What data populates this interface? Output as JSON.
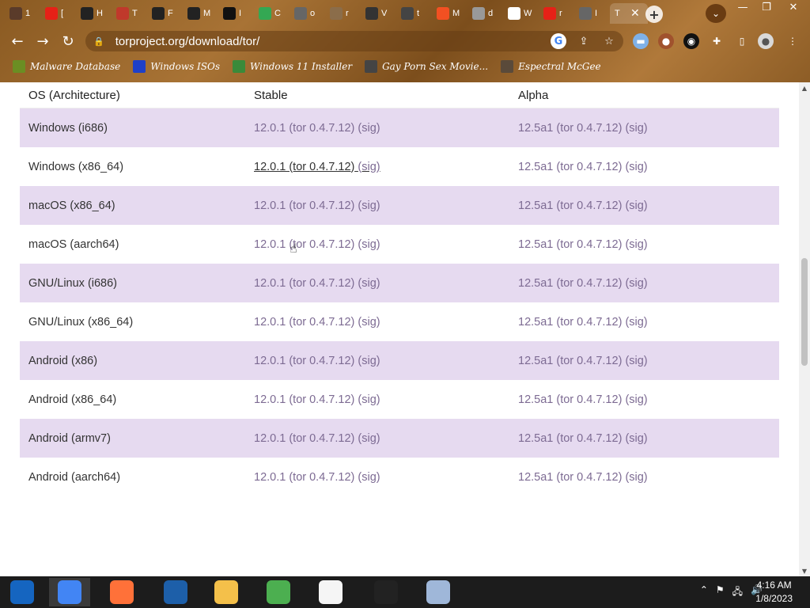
{
  "browser": {
    "tabs": [
      {
        "label": "1",
        "icon": "panda-icon",
        "color": "#5a3b2a"
      },
      {
        "label": "[",
        "icon": "youtube-icon",
        "color": "#e62117"
      },
      {
        "label": "H",
        "icon": "mask-icon",
        "color": "#222222"
      },
      {
        "label": "T",
        "icon": "bookmark-icon",
        "color": "#c0392b"
      },
      {
        "label": "F",
        "icon": "mask-icon",
        "color": "#222222"
      },
      {
        "label": "M",
        "icon": "mask-icon",
        "color": "#222222"
      },
      {
        "label": "I",
        "icon": "ip-icon",
        "color": "#111111"
      },
      {
        "label": "C",
        "icon": "maps-icon",
        "color": "#34a853"
      },
      {
        "label": "o",
        "icon": "globe-icon",
        "color": "#666666"
      },
      {
        "label": "r",
        "icon": "cookie-icon",
        "color": "#8b6d4a"
      },
      {
        "label": "V",
        "icon": "museum-icon",
        "color": "#333333"
      },
      {
        "label": "t",
        "icon": "vs-icon",
        "color": "#444444"
      },
      {
        "label": "M",
        "icon": "windows-icon",
        "color": "#f25022"
      },
      {
        "label": "d",
        "icon": "badge-icon",
        "color": "#999999"
      },
      {
        "label": "W",
        "icon": "wikipedia-icon",
        "color": "#ffffff"
      },
      {
        "label": "r",
        "icon": "youtube-icon",
        "color": "#e62117"
      },
      {
        "label": "I",
        "icon": "globe-icon",
        "color": "#666666"
      }
    ],
    "active_tab": {
      "label": "T",
      "close": "✕"
    },
    "new_tab": "+",
    "tab_search": "⌄",
    "window_controls": {
      "minimize": "—",
      "restore": "❐",
      "close": "✕"
    },
    "url": "torproject.org/download/tor/",
    "bookmarks": [
      {
        "label": "Malware Database",
        "icon": "malware-icon"
      },
      {
        "label": "Windows ISOs",
        "icon": "windows-x-icon"
      },
      {
        "label": "Windows 11 Installer",
        "icon": "installer-icon"
      },
      {
        "label": "Gay Porn Sex Movie...",
        "icon": "film-icon"
      },
      {
        "label": "Espectral McGee",
        "icon": "ghost-icon"
      }
    ]
  },
  "table": {
    "headers": {
      "os": "OS (Architecture)",
      "stable": "Stable",
      "alpha": "Alpha"
    },
    "rows": [
      {
        "os": "Windows (i686)",
        "stable": "12.0.1 (tor 0.4.7.12)",
        "stable_sig": "(sig)",
        "alpha": "12.5a1 (tor 0.4.7.12)",
        "alpha_sig": "(sig)"
      },
      {
        "os": "Windows (x86_64)",
        "stable": "12.0.1 (tor 0.4.7.12)",
        "stable_sig": "(sig)",
        "alpha": "12.5a1 (tor 0.4.7.12)",
        "alpha_sig": "(sig)"
      },
      {
        "os": "macOS (x86_64)",
        "stable": "12.0.1 (tor 0.4.7.12)",
        "stable_sig": "(sig)",
        "alpha": "12.5a1 (tor 0.4.7.12)",
        "alpha_sig": "(sig)"
      },
      {
        "os": "macOS (aarch64)",
        "stable": "12.0.1 (tor 0.4.7.12)",
        "stable_sig": "(sig)",
        "alpha": "12.5a1 (tor 0.4.7.12)",
        "alpha_sig": "(sig)"
      },
      {
        "os": "GNU/Linux (i686)",
        "stable": "12.0.1 (tor 0.4.7.12)",
        "stable_sig": "(sig)",
        "alpha": "12.5a1 (tor 0.4.7.12)",
        "alpha_sig": "(sig)"
      },
      {
        "os": "GNU/Linux (x86_64)",
        "stable": "12.0.1 (tor 0.4.7.12)",
        "stable_sig": "(sig)",
        "alpha": "12.5a1 (tor 0.4.7.12)",
        "alpha_sig": "(sig)"
      },
      {
        "os": "Android (x86)",
        "stable": "12.0.1 (tor 0.4.7.12)",
        "stable_sig": "(sig)",
        "alpha": "12.5a1 (tor 0.4.7.12)",
        "alpha_sig": "(sig)"
      },
      {
        "os": "Android (x86_64)",
        "stable": "12.0.1 (tor 0.4.7.12)",
        "stable_sig": "(sig)",
        "alpha": "12.5a1 (tor 0.4.7.12)",
        "alpha_sig": "(sig)"
      },
      {
        "os": "Android (armv7)",
        "stable": "12.0.1 (tor 0.4.7.12)",
        "stable_sig": "(sig)",
        "alpha": "12.5a1 (tor 0.4.7.12)",
        "alpha_sig": "(sig)"
      },
      {
        "os": "Android (aarch64)",
        "stable": "12.0.1 (tor 0.4.7.12)",
        "stable_sig": "(sig)",
        "alpha": "12.5a1 (tor 0.4.7.12)",
        "alpha_sig": "(sig)"
      }
    ],
    "shade_color": "#e6daf0",
    "link_color": "#7d6b93"
  },
  "taskbar": {
    "apps": [
      {
        "name": "windows-start-icon",
        "color": "#1565c0"
      },
      {
        "name": "chrome-icon",
        "color": "#4285f4"
      },
      {
        "name": "firefox-icon",
        "color": "#ff7139"
      },
      {
        "name": "obama-logo-icon",
        "color": "#1d5fa9"
      },
      {
        "name": "file-explorer-icon",
        "color": "#f4c04a"
      },
      {
        "name": "network-icon",
        "color": "#4caf50"
      },
      {
        "name": "vs-app-icon",
        "color": "#f5f5f5"
      },
      {
        "name": "warning-app-icon",
        "color": "#222222"
      },
      {
        "name": "disc-app-icon",
        "color": "#9fb7d9"
      }
    ],
    "tray": {
      "chevron": "⌃",
      "flag": "⚑",
      "network": "🖧",
      "volume": "🔊"
    },
    "time": "4:16 AM",
    "date": "1/8/2023"
  }
}
